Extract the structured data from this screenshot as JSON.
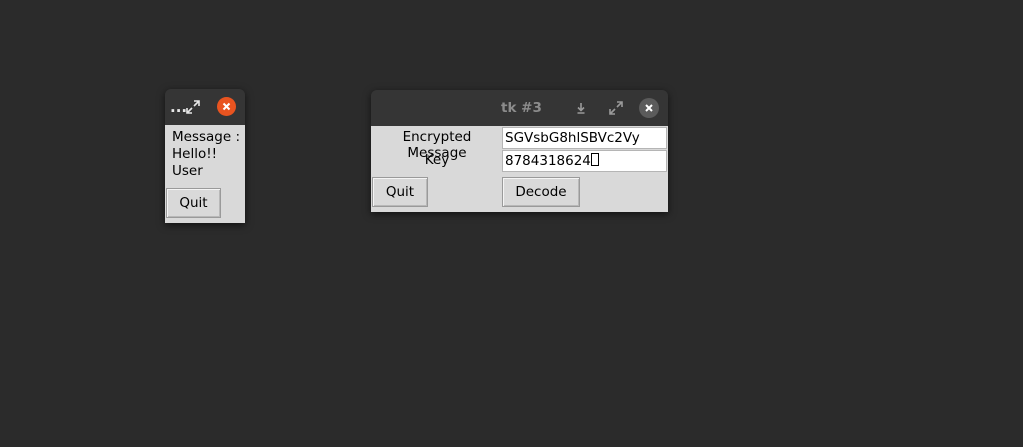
{
  "small_window": {
    "title": "...",
    "message_label": "Message :\nHello!!\nUser",
    "quit_label": "Quit"
  },
  "big_window": {
    "title": "tk #3",
    "encrypted_label": "Encrypted Message",
    "encrypted_value": "SGVsbG8hlSBVc2Vy",
    "key_label": "Key",
    "key_value": "8784318624",
    "quit_label": "Quit",
    "decode_label": "Decode"
  },
  "colors": {
    "desktop": "#2b2b2b",
    "titlebar": "#353535",
    "window_body": "#d9d9d9",
    "close_accent": "#e95420"
  },
  "icons": {
    "small_maximize": "maximize-icon",
    "small_close": "close-icon",
    "big_minimize": "minimize-icon",
    "big_maximize": "maximize-icon",
    "big_close": "close-icon"
  }
}
